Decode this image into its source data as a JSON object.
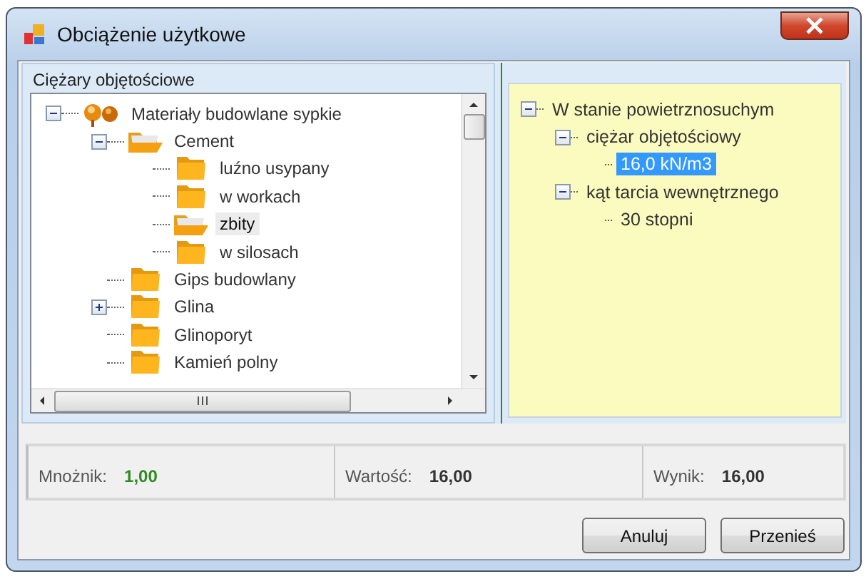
{
  "window": {
    "title": "Obciążenie użytkowe"
  },
  "group": {
    "title": "Ciężary objętościowe"
  },
  "tree": {
    "items": [
      {
        "label": "Materiały budowlane sypkie",
        "kind": "group",
        "expanded": true,
        "selected": false,
        "children": [
          {
            "label": "Cement",
            "kind": "folder",
            "expanded": true,
            "selected": false,
            "children": [
              {
                "label": "luźno usypany",
                "kind": "folder",
                "selected": false
              },
              {
                "label": "w workach",
                "kind": "folder",
                "selected": false
              },
              {
                "label": "zbity",
                "kind": "folder",
                "selected": true
              },
              {
                "label": "w silosach",
                "kind": "folder",
                "selected": false
              }
            ]
          },
          {
            "label": "Gips budowlany",
            "kind": "folder",
            "selected": false
          },
          {
            "label": "Glina",
            "kind": "folder",
            "expanded": false,
            "selected": false
          },
          {
            "label": "Glinoporyt",
            "kind": "folder",
            "selected": false
          },
          {
            "label": "Kamień polny",
            "kind": "folder",
            "selected": false
          }
        ]
      }
    ]
  },
  "details": {
    "items": [
      {
        "label": "W stanie powietrznosuchym",
        "expanded": true,
        "selected": false,
        "children": [
          {
            "label": "ciężar objętościowy",
            "expanded": true,
            "selected": false,
            "children": [
              {
                "label": "16,0 kN/m3",
                "selected": true
              }
            ]
          },
          {
            "label": "kąt tarcia wewnętrznego",
            "expanded": true,
            "selected": false,
            "children": [
              {
                "label": "30 stopni",
                "selected": false
              }
            ]
          }
        ]
      }
    ]
  },
  "summary": [
    {
      "label": "Mnożnik:",
      "value": "1,00",
      "color": "#2e8b24"
    },
    {
      "label": "Wartość:",
      "value": "16,00",
      "color": "#333333"
    },
    {
      "label": "Wynik:",
      "value": "16,00",
      "color": "#333333"
    }
  ],
  "buttons": [
    "Anuluj",
    "Przenieś"
  ]
}
